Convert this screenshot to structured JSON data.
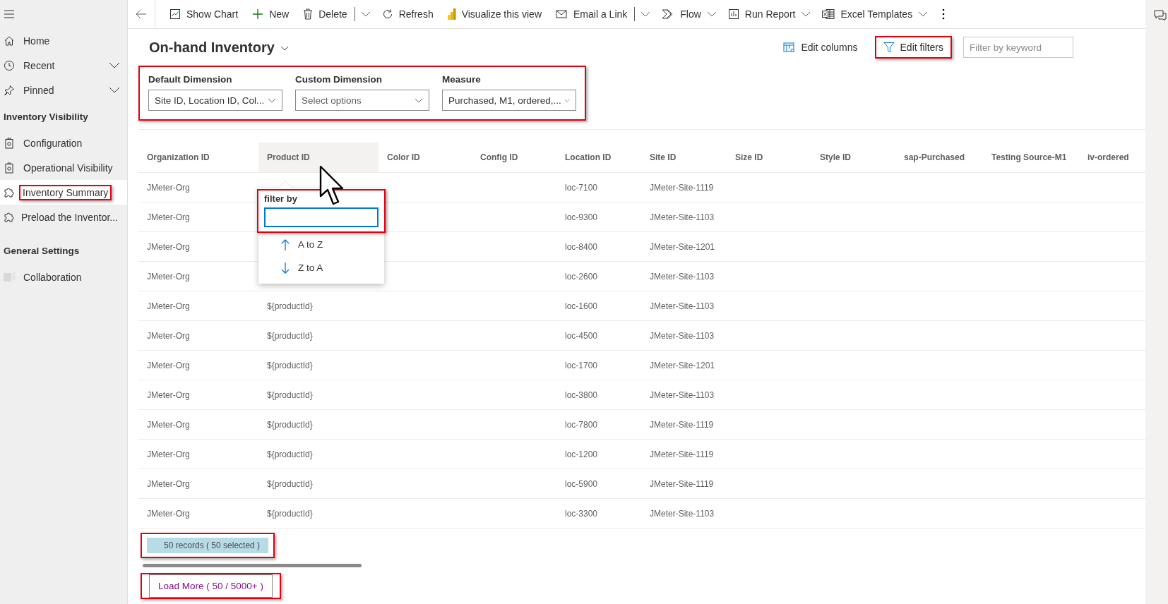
{
  "sidebar": {
    "items": [
      {
        "kind": "nav",
        "label": "Home",
        "expandable": false,
        "selected": false,
        "highlighted": false
      },
      {
        "kind": "nav",
        "label": "Recent",
        "expandable": true,
        "selected": false,
        "highlighted": false
      },
      {
        "kind": "nav",
        "label": "Pinned",
        "expandable": true,
        "selected": false,
        "highlighted": false
      },
      {
        "kind": "section",
        "label": "Inventory Visibility"
      },
      {
        "kind": "nav",
        "label": "Configuration",
        "expandable": false,
        "selected": false,
        "highlighted": false
      },
      {
        "kind": "nav",
        "label": "Operational Visibility",
        "expandable": false,
        "selected": false,
        "highlighted": false
      },
      {
        "kind": "nav",
        "label": "Inventory Summary",
        "expandable": false,
        "selected": true,
        "highlighted": true
      },
      {
        "kind": "nav",
        "label": "Preload the Inventor...",
        "expandable": false,
        "selected": false,
        "highlighted": false
      },
      {
        "kind": "section",
        "label": "General Settings"
      },
      {
        "kind": "nav",
        "label": "Collaboration",
        "expandable": false,
        "selected": false,
        "highlighted": false
      }
    ]
  },
  "toolbar": {
    "items": [
      {
        "label": "Show Chart",
        "kind": "plain"
      },
      {
        "label": "New",
        "kind": "plain"
      },
      {
        "label": "Delete",
        "kind": "split"
      },
      {
        "label": "Refresh",
        "kind": "plain"
      },
      {
        "label": "Visualize this view",
        "kind": "plain"
      },
      {
        "label": "Email a Link",
        "kind": "split"
      },
      {
        "label": "Flow",
        "kind": "dropdown"
      },
      {
        "label": "Run Report",
        "kind": "dropdown"
      },
      {
        "label": "Excel Templates",
        "kind": "dropdown"
      }
    ]
  },
  "header": {
    "title": "On-hand Inventory",
    "edit_columns": "Edit columns",
    "edit_filters": {
      "label": "Edit filters",
      "highlighted": true
    },
    "keyword_search": {
      "placeholder": "Filter by keyword"
    }
  },
  "dimensions": {
    "highlighted": true,
    "fields": [
      {
        "label": "Default Dimension",
        "value": "Site ID, Location ID, Col..."
      },
      {
        "label": "Custom Dimension",
        "placeholder": "Select options"
      },
      {
        "label": "Measure",
        "value": "Purchased, M1, ordered,..."
      }
    ]
  },
  "grid": {
    "columns": [
      {
        "label": "Organization ID",
        "hovered": false
      },
      {
        "label": "Product ID",
        "hovered": true
      },
      {
        "label": "Color ID",
        "hovered": false
      },
      {
        "label": "Config ID",
        "hovered": false
      },
      {
        "label": "Location ID",
        "hovered": false
      },
      {
        "label": "Site ID",
        "hovered": false
      },
      {
        "label": "Size ID",
        "hovered": false
      },
      {
        "label": "Style ID",
        "hovered": false
      },
      {
        "label": "sap-Purchased",
        "hovered": false
      },
      {
        "label": "Testing Source-M1",
        "hovered": false
      },
      {
        "label": "iv-ordered",
        "hovered": false
      }
    ],
    "rows": [
      {
        "organization_id": "JMeter-Org",
        "location_id": "loc-7100",
        "site_id": "JMeter-Site-1119"
      },
      {
        "organization_id": "JMeter-Org",
        "location_id": "loc-9300",
        "site_id": "JMeter-Site-1103"
      },
      {
        "organization_id": "JMeter-Org",
        "location_id": "loc-8400",
        "site_id": "JMeter-Site-1201"
      },
      {
        "organization_id": "JMeter-Org",
        "location_id": "loc-2600",
        "site_id": "JMeter-Site-1103"
      },
      {
        "organization_id": "JMeter-Org",
        "product_id": "${productId}",
        "location_id": "loc-1600",
        "site_id": "JMeter-Site-1103"
      },
      {
        "organization_id": "JMeter-Org",
        "product_id": "${productId}",
        "location_id": "loc-4500",
        "site_id": "JMeter-Site-1103"
      },
      {
        "organization_id": "JMeter-Org",
        "product_id": "${productId}",
        "location_id": "loc-1700",
        "site_id": "JMeter-Site-1201"
      },
      {
        "organization_id": "JMeter-Org",
        "product_id": "${productId}",
        "location_id": "loc-3800",
        "site_id": "JMeter-Site-1103"
      },
      {
        "organization_id": "JMeter-Org",
        "product_id": "${productId}",
        "location_id": "loc-7800",
        "site_id": "JMeter-Site-1119"
      },
      {
        "organization_id": "JMeter-Org",
        "product_id": "${productId}",
        "location_id": "loc-1200",
        "site_id": "JMeter-Site-1119"
      },
      {
        "organization_id": "JMeter-Org",
        "product_id": "${productId}",
        "location_id": "loc-5900",
        "site_id": "JMeter-Site-1119"
      },
      {
        "organization_id": "JMeter-Org",
        "product_id": "${productId}",
        "location_id": "loc-3300",
        "site_id": "JMeter-Site-1103"
      }
    ]
  },
  "filter_popup": {
    "highlighted": true,
    "label": "filter by",
    "sort_options": [
      {
        "kind": "ascending",
        "label": "A to Z"
      },
      {
        "kind": "descending",
        "label": "Z to A"
      }
    ]
  },
  "footer": {
    "record_count": {
      "label": "50 records ( 50 selected )",
      "highlighted": true
    },
    "load_more": {
      "label": "Load More ( 50 / 5000+ )",
      "highlighted": true
    }
  }
}
